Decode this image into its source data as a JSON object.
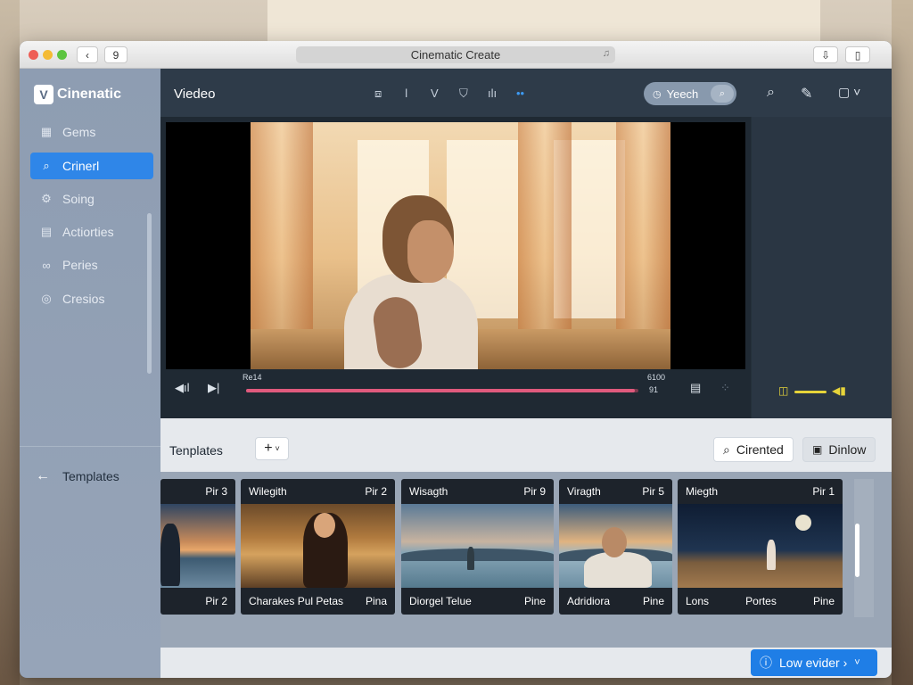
{
  "window": {
    "title": "Cinematic Create",
    "nav_back": "‹",
    "nav_extra": "9",
    "addr_icon": "♫",
    "right_btn_1": "⇩",
    "right_btn_2": "▯"
  },
  "sidebar": {
    "brand": "Cinenatic",
    "brand_logo": "V",
    "items": [
      {
        "label": "Gems",
        "icon": "grid-icon"
      },
      {
        "label": "Crinerl",
        "icon": "search-icon"
      },
      {
        "label": "Soing",
        "icon": "gear-icon"
      },
      {
        "label": "Actiorties",
        "icon": "book-icon"
      },
      {
        "label": "Peries",
        "icon": "link-icon"
      },
      {
        "label": "Cresios",
        "icon": "target-icon"
      }
    ],
    "templates_label": "Templates"
  },
  "header": {
    "title": "Viedeo",
    "search_label": "Yeech"
  },
  "player": {
    "time_left": "Re14",
    "time_right_top": "6100",
    "time_right_bottom": "91",
    "progress": 0.99
  },
  "templates_bar": {
    "title": "Tenplates",
    "add_label": "+",
    "search_button": "Cirented",
    "second_button": "Dinlow"
  },
  "cards": [
    {
      "title": "",
      "badge": "Pir 3",
      "foot_left": "",
      "foot_mid": "",
      "foot_right": "Pir 2",
      "image": "sunset"
    },
    {
      "title": "Wilegith",
      "badge": "Pir 2",
      "foot_left": "Charakes Pul Petas",
      "foot_mid": "",
      "foot_right": "Pina",
      "image": "indoor"
    },
    {
      "title": "Wisagth",
      "badge": "Pir 9",
      "foot_left": "Diorgel Telue",
      "foot_mid": "",
      "foot_right": "Pine",
      "image": "sea"
    },
    {
      "title": "Viragth",
      "badge": "Pir 5",
      "foot_left": "Adridiora",
      "foot_mid": "",
      "foot_right": "Pine",
      "image": "beach"
    },
    {
      "title": "Miegth",
      "badge": "Pir 1",
      "foot_left": "Lons",
      "foot_mid": "Portes",
      "foot_right": "Pine",
      "image": "night"
    }
  ],
  "bottom": {
    "low_button": "Low evider ›"
  },
  "colors": {
    "accent": "#2f86e8",
    "progress": "#e05a7d",
    "volume": "#e6d43a"
  }
}
